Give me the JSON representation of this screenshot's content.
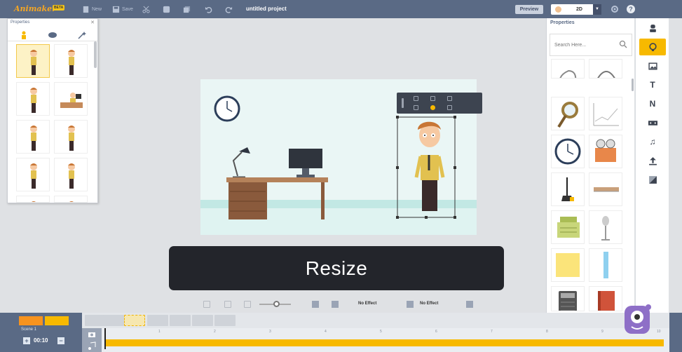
{
  "app": {
    "logo": "Animaker",
    "badge": "BETA",
    "title": "untitled project",
    "toolbar": {
      "new": "New",
      "save": "Save"
    },
    "preview": "Preview",
    "mode": "2D"
  },
  "properties_panel": {
    "title": "Properties"
  },
  "library_panel": {
    "title": "Properties",
    "search_placeholder": "Search Here..."
  },
  "caption": {
    "text": "Resize"
  },
  "controls": {
    "effect_in": "No Effect",
    "effect_out": "No Effect"
  },
  "timeline": {
    "scene_label": "Scene 1",
    "duration": "00:10",
    "ruler": [
      "1",
      "2",
      "3",
      "4",
      "5",
      "6",
      "7",
      "8",
      "9",
      "10"
    ]
  },
  "colors": {
    "accent": "#f7b900",
    "topbar": "#5a6a85",
    "orange": "#f7931e"
  },
  "icons": {
    "rail": [
      "character-icon",
      "prop-icon",
      "background-icon",
      "text-icon",
      "number-icon",
      "video-icon",
      "music-icon",
      "upload-icon",
      "effect-icon"
    ]
  }
}
